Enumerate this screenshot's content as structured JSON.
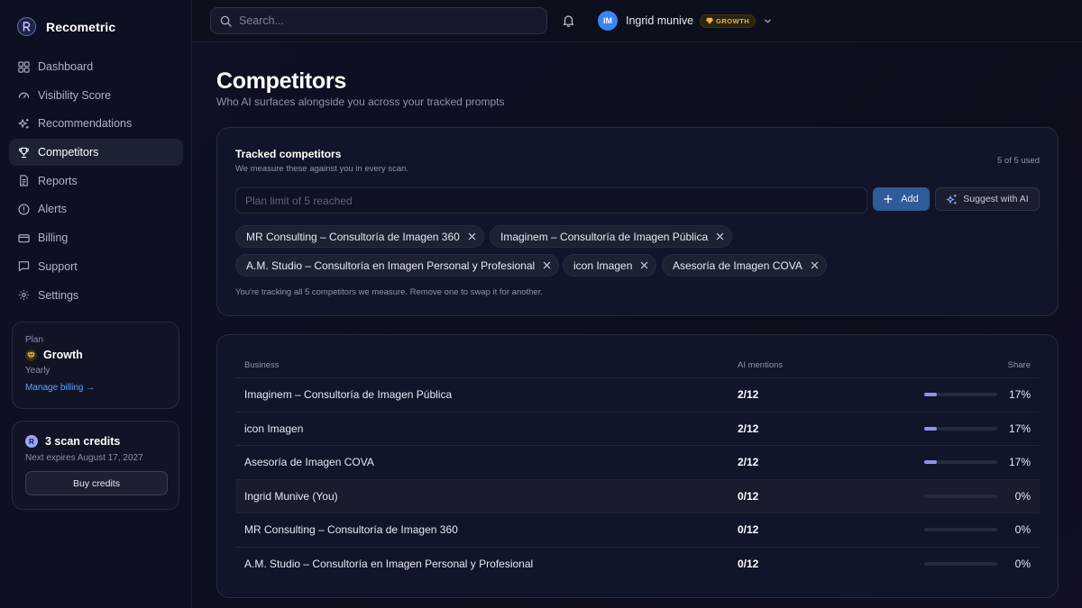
{
  "brand": {
    "name": "Recometric",
    "logo_icon": "recometric-r-logo"
  },
  "nav": {
    "items": [
      {
        "label": "Dashboard",
        "icon": "grid-icon"
      },
      {
        "label": "Visibility Score",
        "icon": "gauge-icon"
      },
      {
        "label": "Recommendations",
        "icon": "sparkle-icon"
      },
      {
        "label": "Competitors",
        "icon": "trophy-icon",
        "active": true
      },
      {
        "label": "Reports",
        "icon": "document-icon"
      },
      {
        "label": "Alerts",
        "icon": "alert-circle-icon"
      },
      {
        "label": "Billing",
        "icon": "credit-card-icon"
      },
      {
        "label": "Support",
        "icon": "chat-icon"
      },
      {
        "label": "Settings",
        "icon": "gear-icon"
      }
    ]
  },
  "plan": {
    "label": "Plan",
    "name": "Growth",
    "period": "Yearly",
    "link": "Manage billing →"
  },
  "credits": {
    "badge": "R",
    "title": "3 scan credits",
    "sub": "Next expires August 17, 2027",
    "button": "Buy credits"
  },
  "topbar": {
    "search_placeholder": "Search...",
    "user": {
      "initials": "IM",
      "name": "Ingrid munive",
      "tier": "GROWTH"
    }
  },
  "page": {
    "title": "Competitors",
    "subtitle": "Who AI surfaces alongside you across your tracked prompts"
  },
  "tracked": {
    "title": "Tracked competitors",
    "subtitle": "We measure these against you in every scan.",
    "used": "5 of 5 used",
    "input_placeholder": "Plan limit of 5 reached",
    "add_label": "Add",
    "suggest_label": "Suggest with AI",
    "chips": [
      "MR Consulting – Consultoría de Imagen 360",
      "Imaginem – Consultoría de Imagen Pública",
      "A.M. Studio – Consultoría en Imagen Personal y Profesional",
      "icon Imagen",
      "Asesoría de Imagen COVA"
    ],
    "note": "You're tracking all 5 competitors we measure. Remove one to swap it for another."
  },
  "table": {
    "headers": {
      "business": "Business",
      "mentions": "AI mentions",
      "share": "Share"
    },
    "rows": [
      {
        "business": "Imaginem – Consultoría de Imagen Pública",
        "mentions": "2/12",
        "share": "17%",
        "share_value": 0.17
      },
      {
        "business": "icon Imagen",
        "mentions": "2/12",
        "share": "17%",
        "share_value": 0.17
      },
      {
        "business": "Asesoría de Imagen COVA",
        "mentions": "2/12",
        "share": "17%",
        "share_value": 0.17
      },
      {
        "business": "Ingrid Munive (You)",
        "mentions": "0/12",
        "share": "0%",
        "share_value": 0,
        "is_you": true
      },
      {
        "business": "MR Consulting – Consultoría de Imagen 360",
        "mentions": "0/12",
        "share": "0%",
        "share_value": 0
      },
      {
        "business": "A.M. Studio – Consultoría en Imagen Personal y Profesional",
        "mentions": "0/12",
        "share": "0%",
        "share_value": 0
      }
    ]
  },
  "colors": {
    "accent": "#3b82f6",
    "bar_fill": "#8f93f3",
    "tier_gold": "#e8b54a",
    "link": "#5aa6ff"
  }
}
